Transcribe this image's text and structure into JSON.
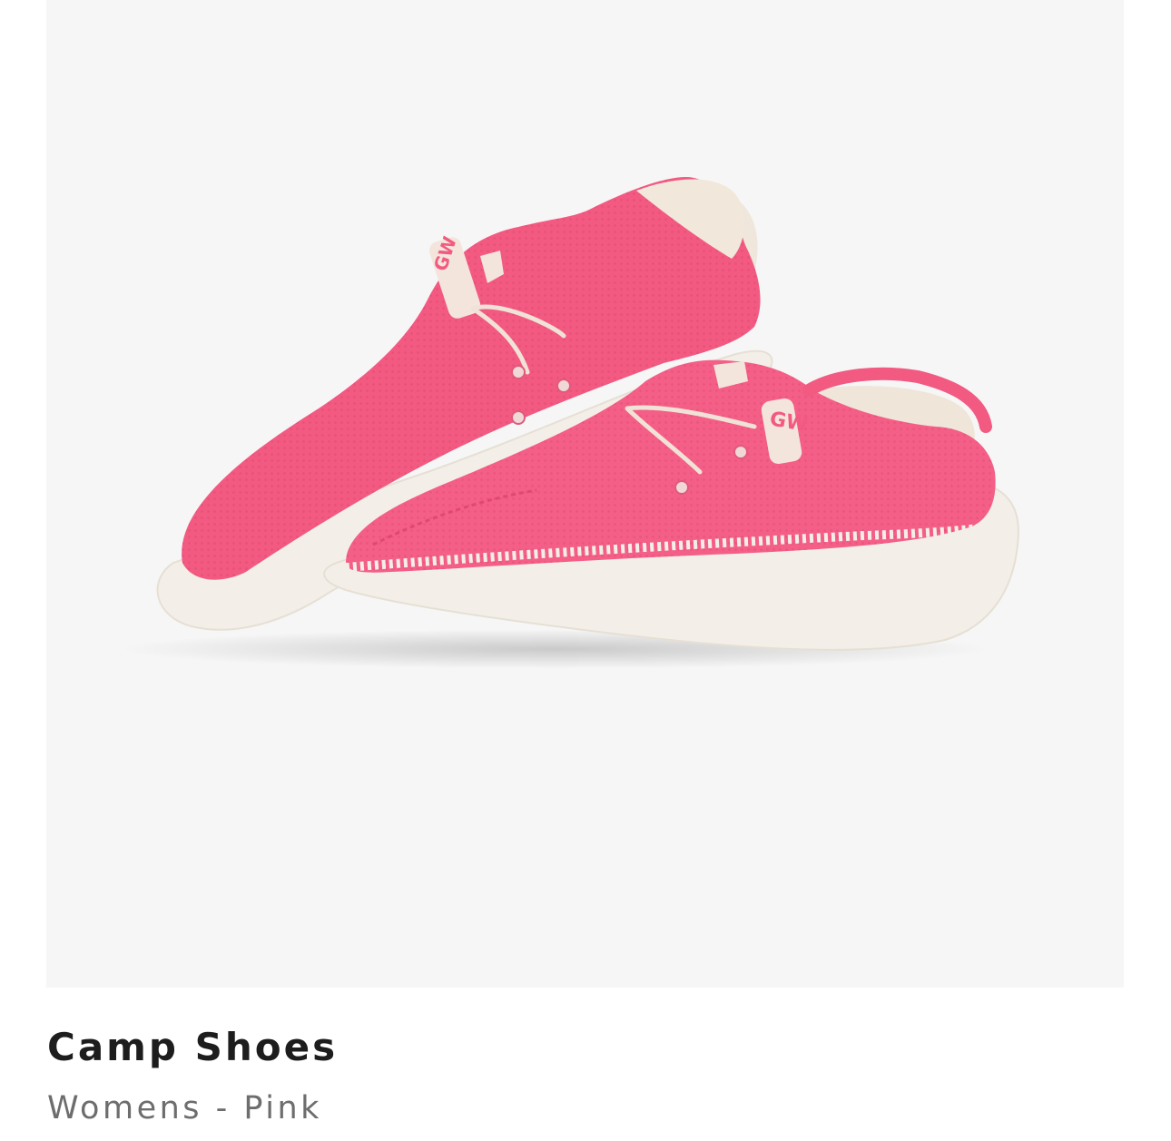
{
  "product": {
    "name": "Camp Shoes",
    "variant": "Womens - Pink",
    "colors": {
      "background": "#f6f6f6",
      "shoe": "#f25a82",
      "sole": "#f3efe8"
    }
  }
}
